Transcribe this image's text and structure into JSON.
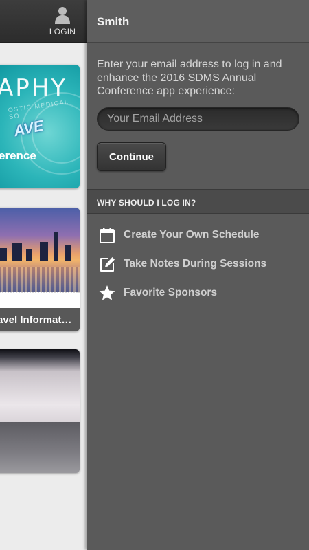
{
  "topbar": {
    "login_label": "LOGIN"
  },
  "tiles": {
    "tile1": {
      "big_text": "APHY",
      "wave_text": "AVE",
      "sub_text": "erence",
      "small_text": "OSTIC MEDICAL SO"
    },
    "tile2": {
      "caption": "avel Informat…"
    }
  },
  "drawer": {
    "user_name": "Smith",
    "prompt": "Enter your email address to log in and enhance the 2016 SDMS Annual Conference app experience:",
    "email_placeholder": "Your Email Address",
    "email_value": "",
    "continue_label": "Continue",
    "section_title": "WHY SHOULD I LOG IN?",
    "benefits": [
      {
        "icon": "calendar-icon",
        "label": "Create Your Own Schedule"
      },
      {
        "icon": "pencil-square-icon",
        "label": "Take Notes During Sessions"
      },
      {
        "icon": "star-icon",
        "label": "Favorite Sponsors"
      }
    ]
  },
  "colors": {
    "drawer_bg": "#5a5a5a",
    "topbar_bg": "#333333",
    "text_light": "#d5d5d5",
    "teal_tile": "#2cb5b9"
  }
}
